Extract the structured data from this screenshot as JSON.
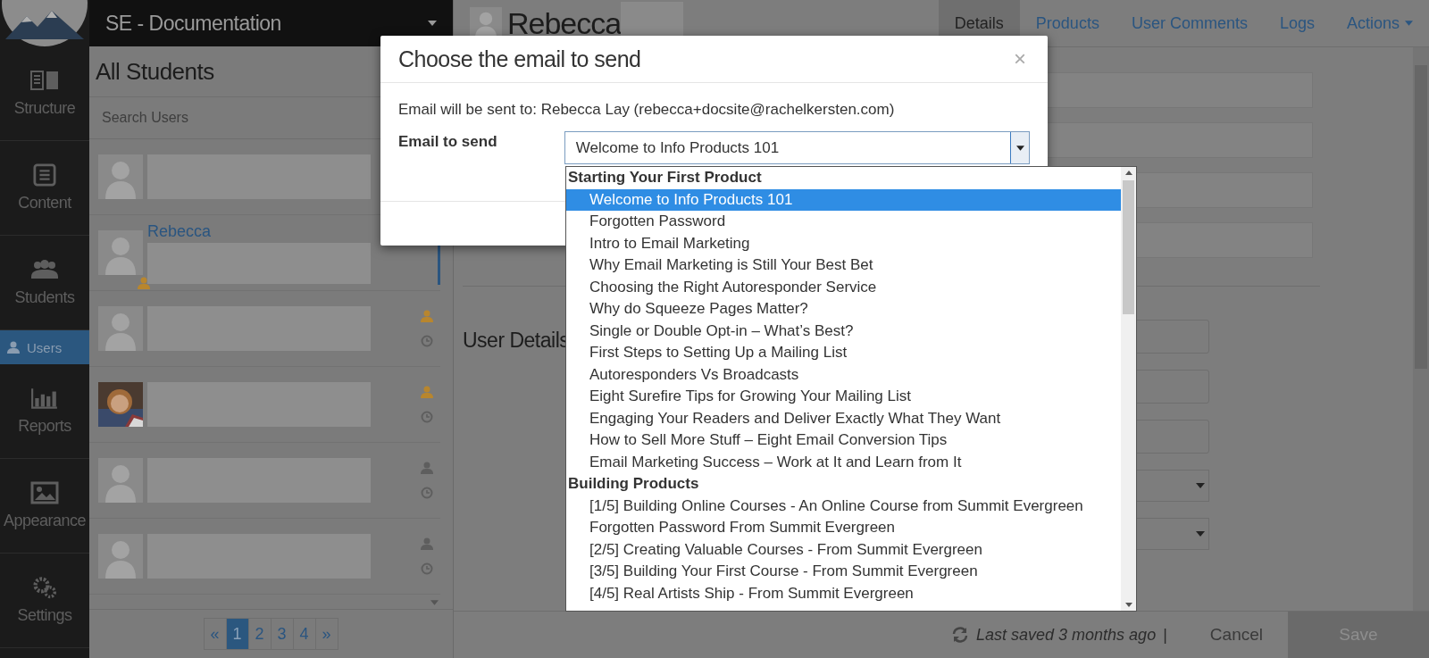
{
  "workspace": {
    "title": "SE - Documentation"
  },
  "nav": [
    {
      "label": "Structure",
      "kind": "main",
      "selected": false
    },
    {
      "label": "Content",
      "kind": "main",
      "selected": false
    },
    {
      "label": "Students",
      "kind": "main",
      "selected": false
    },
    {
      "label": "Users",
      "kind": "sub",
      "selected": true
    },
    {
      "label": "Reports",
      "kind": "main",
      "selected": false
    },
    {
      "label": "Appearance",
      "kind": "main",
      "selected": false
    },
    {
      "label": "Settings",
      "kind": "main",
      "selected": false
    }
  ],
  "students": {
    "title": "All Students",
    "search": {
      "placeholder": "Search Users"
    },
    "rows": [
      {
        "photo": false,
        "selected": false,
        "clock": false
      },
      {
        "photo": false,
        "name": "Rebecca",
        "selected": true,
        "color": "#b8862e",
        "clock": false
      },
      {
        "photo": false,
        "selected": false,
        "color": "#b8862e",
        "clock": true
      },
      {
        "photo": true,
        "selected": false,
        "color": "#b8862e",
        "clock": true
      },
      {
        "photo": false,
        "selected": false,
        "color": "#5e5e5e",
        "clock": true
      },
      {
        "photo": false,
        "selected": false,
        "color": "#5e5e5e",
        "clock": true
      }
    ],
    "pages": [
      {
        "label": "«",
        "selected": false
      },
      {
        "label": "1",
        "selected": true
      },
      {
        "label": "2",
        "selected": false
      },
      {
        "label": "3",
        "selected": false
      },
      {
        "label": "4",
        "selected": false
      },
      {
        "label": "»",
        "selected": false
      }
    ]
  },
  "user": {
    "name": "Rebecca",
    "tabs": [
      {
        "label": "Details",
        "selected": true
      },
      {
        "label": "Products",
        "selected": false
      },
      {
        "label": "User Comments",
        "selected": false
      },
      {
        "label": "Logs",
        "selected": false
      },
      {
        "label": "Actions",
        "selected": false,
        "menu": true
      }
    ],
    "section": "User Details",
    "status": "Last saved 3 months ago",
    "separator": "|",
    "buttons": [
      {
        "label": "Cancel",
        "kind": "link"
      },
      {
        "label": "Save",
        "kind": "primary"
      }
    ]
  },
  "modal": {
    "title": "Choose the email to send",
    "close": "×",
    "recipient": "Email will be sent to: Rebecca Lay (rebecca+docsite@rachelkersten.com)",
    "field_label": "Email to send",
    "select": {
      "value": "Welcome to Info Products 101",
      "expanded": true
    },
    "groups": [
      {
        "label": "Starting Your First Product",
        "items": [
          {
            "label": "Welcome to Info Products 101",
            "selected": true
          },
          {
            "label": "Forgotten Password",
            "selected": false
          },
          {
            "label": "Intro to Email Marketing",
            "selected": false
          },
          {
            "label": "Why Email Marketing is Still Your Best Bet",
            "selected": false
          },
          {
            "label": "Choosing the Right Autoresponder Service",
            "selected": false
          },
          {
            "label": "Why do Squeeze Pages Matter?",
            "selected": false
          },
          {
            "label": "Single or Double Opt-in – What’s Best?",
            "selected": false
          },
          {
            "label": "First Steps to Setting Up a Mailing List",
            "selected": false
          },
          {
            "label": "Autoresponders Vs Broadcasts",
            "selected": false
          },
          {
            "label": "Eight Surefire Tips for Growing Your Mailing List",
            "selected": false
          },
          {
            "label": "Engaging Your Readers and Deliver Exactly What They Want",
            "selected": false
          },
          {
            "label": "How to Sell More Stuff – Eight Email Conversion Tips",
            "selected": false
          },
          {
            "label": "Email Marketing Success – Work at It and Learn from It",
            "selected": false
          }
        ]
      },
      {
        "label": "Building Products",
        "items": [
          {
            "label": "[1/5] Building Online Courses - An Online Course from Summit Evergreen",
            "selected": false
          },
          {
            "label": "Forgotten Password From Summit Evergreen",
            "selected": false
          },
          {
            "label": "[2/5] Creating Valuable Courses - From Summit Evergreen",
            "selected": false
          },
          {
            "label": "[3/5] Building Your First Course - From Summit Evergreen",
            "selected": false
          },
          {
            "label": "[4/5] Real Artists Ship - From Summit Evergreen",
            "selected": false
          }
        ]
      }
    ]
  }
}
